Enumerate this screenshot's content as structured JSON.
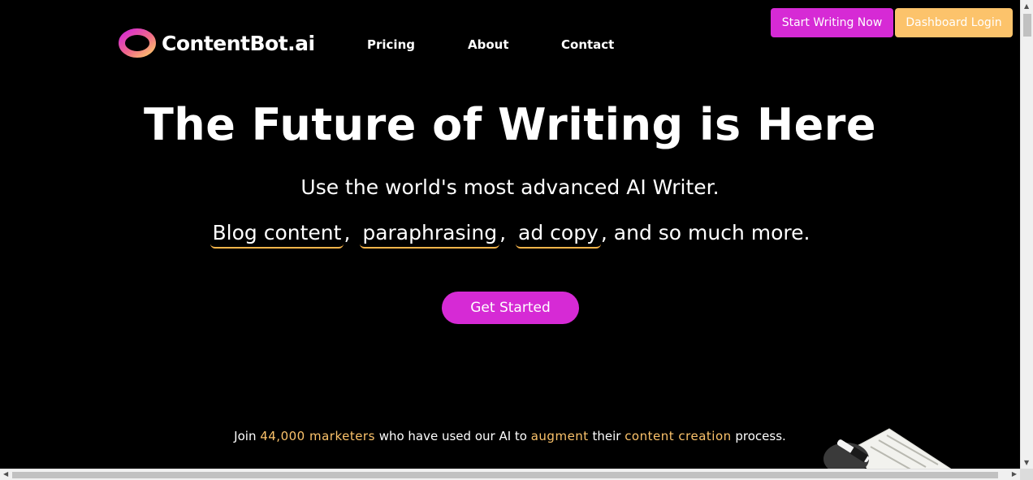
{
  "header": {
    "logo_text": "ContentBot.ai",
    "nav": [
      {
        "label": "Pricing"
      },
      {
        "label": "About"
      },
      {
        "label": "Contact"
      }
    ],
    "start_writing_label": "Start Writing Now",
    "dashboard_login_label": "Dashboard Login"
  },
  "hero": {
    "title": "The Future of Writing is Here",
    "subtitle": "Use the world's most advanced AI Writer.",
    "features": [
      "Blog content",
      "paraphrasing",
      "ad copy"
    ],
    "features_tail": ", and so much more.",
    "cta_label": "Get Started"
  },
  "join": {
    "prefix": "Join ",
    "marketers": "44,000 marketers",
    "mid1": " who have used our AI to ",
    "augment": "augment",
    "mid2": " their ",
    "content_creation": "content creation",
    "suffix": " process."
  },
  "colors": {
    "primary": "#d62ad5",
    "accent": "#fcc36b",
    "background": "#000000"
  },
  "icons": {
    "logo": "logo-ring-icon",
    "illustration": "writing-pen-illustration"
  }
}
